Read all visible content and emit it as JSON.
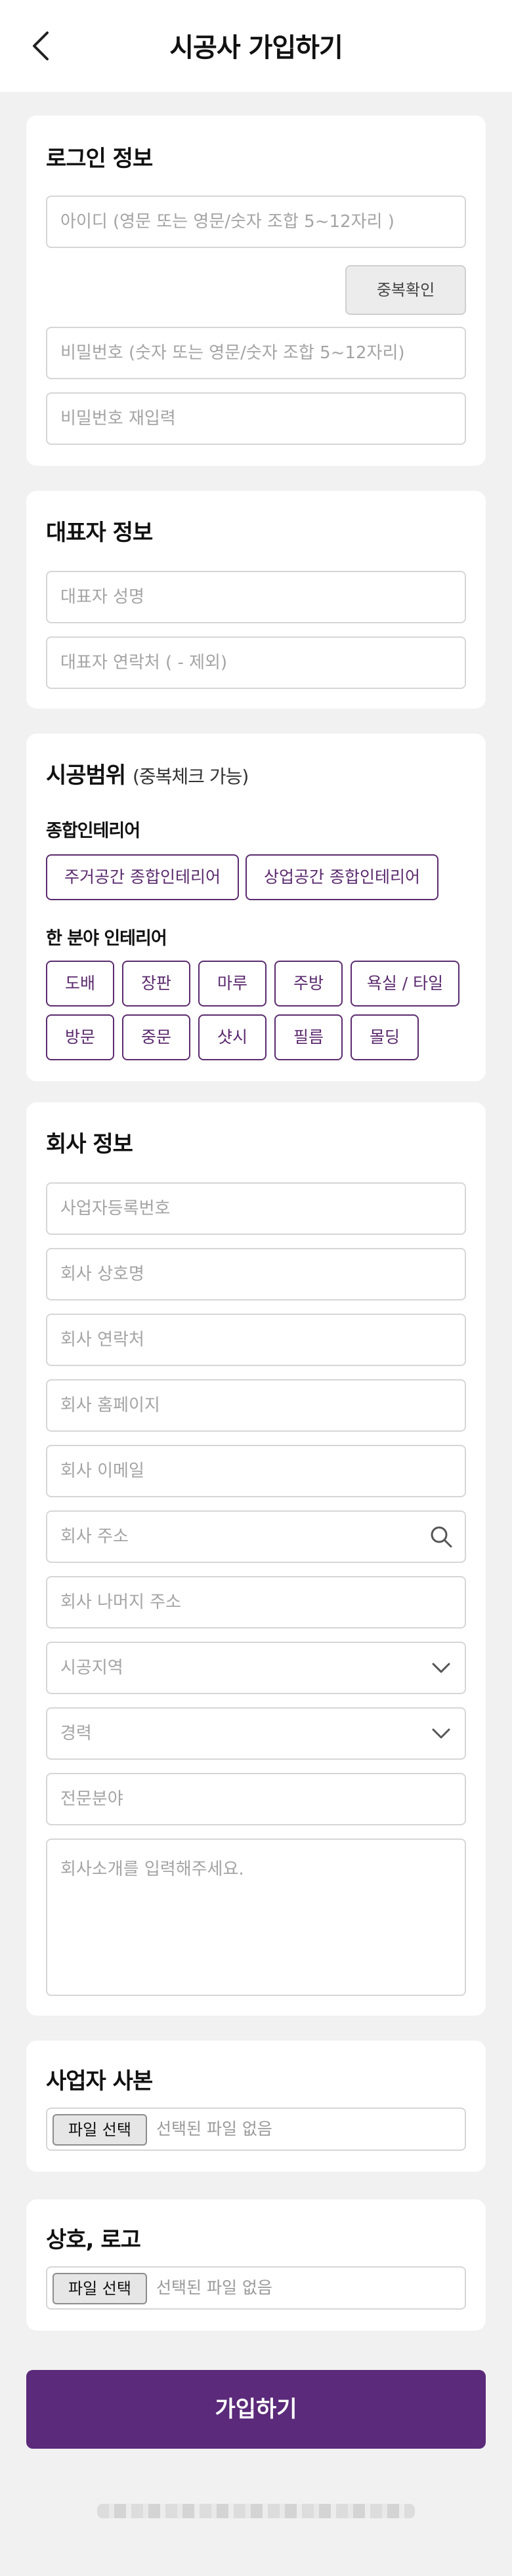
{
  "header": {
    "title": "시공사 가입하기"
  },
  "login": {
    "title": "로그인 정보",
    "id_placeholder": "아이디 (영문 또는 영문/숫자 조합 5~12자리 )",
    "dup_check": "중복확인",
    "pw_placeholder": "비밀번호 (숫자 또는 영문/숫자 조합 5~12자리)",
    "pw_confirm_placeholder": "비밀번호 재입력"
  },
  "rep": {
    "title": "대표자 정보",
    "name_placeholder": "대표자 성명",
    "phone_placeholder": "대표자 연락처 ( - 제외)"
  },
  "scope": {
    "title": "시공범위",
    "subtitle": "(중복체크 가능)",
    "general_label": "종합인테리어",
    "general_items": [
      "주거공간 종합인테리어",
      "상업공간 종합인테리어"
    ],
    "partial_label": "한 분야 인테리어",
    "partial_items": [
      "도배",
      "장판",
      "마루",
      "주방",
      "욕실 / 타일",
      "방문",
      "중문",
      "샷시",
      "필름",
      "몰딩"
    ]
  },
  "company": {
    "title": "회사 정보",
    "biz_no": "사업자등록번호",
    "name": "회사 상호명",
    "phone": "회사 연락처",
    "homepage": "회사 홈페이지",
    "email": "회사 이메일",
    "address": "회사 주소",
    "address_detail": "회사 나머지 주소",
    "region": "시공지역",
    "career": "경력",
    "specialty": "전문분야",
    "intro": "회사소개를 입력해주세요."
  },
  "biz_copy": {
    "title": "사업자 사본",
    "file_button": "파일 선택",
    "file_status": "선택된 파일 없음"
  },
  "logo": {
    "title": "상호, 로고",
    "file_button": "파일 선택",
    "file_status": "선택된 파일 없음"
  },
  "submit_label": "가입하기",
  "icons": {
    "back": "chevron-left-icon",
    "search": "search-icon",
    "dropdown": "chevron-down-icon"
  },
  "colors": {
    "accent": "#5b2a7a",
    "chip_border": "#5b2a6e",
    "background": "#f1f1f1"
  }
}
